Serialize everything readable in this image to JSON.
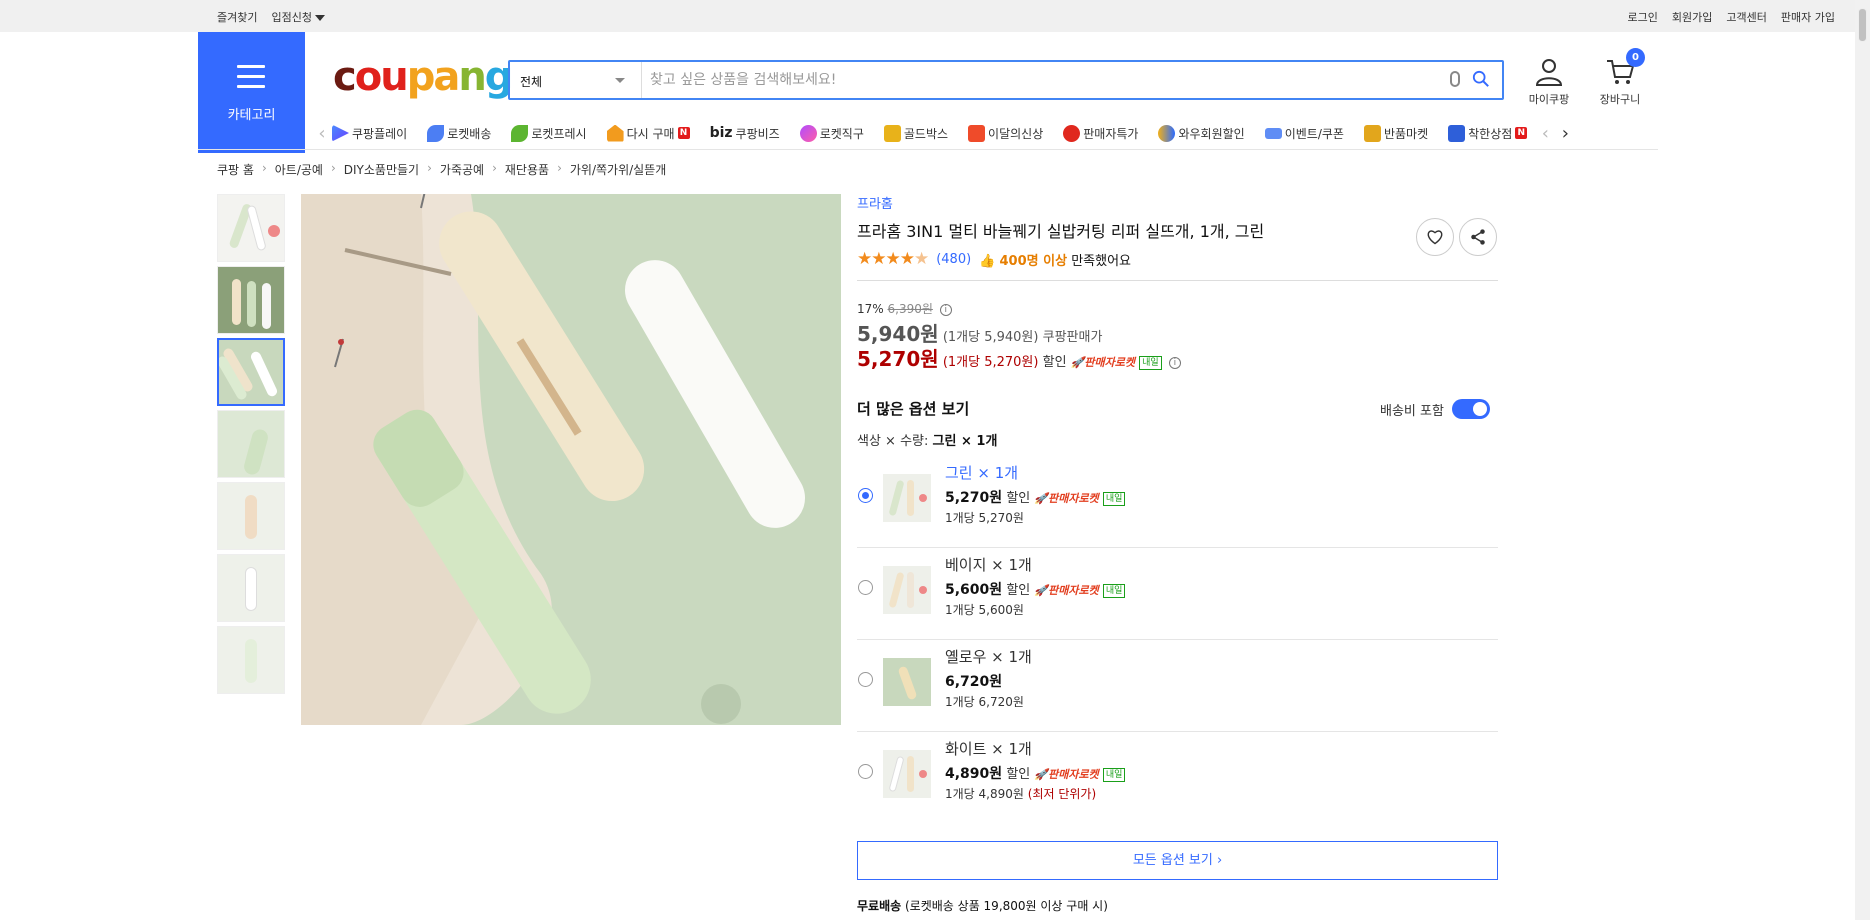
{
  "topbar": {
    "bookmark": "즐겨찾기",
    "apply": "입점신청",
    "login": "로그인",
    "signup": "회원가입",
    "support": "고객센터",
    "seller_signup": "판매자 가입"
  },
  "category_label": "카테고리",
  "logo": {
    "p1": "c",
    "p2": "ou",
    "p3": "pa",
    "p4": "n",
    "p5": "g"
  },
  "search": {
    "category": "전체",
    "placeholder": "찾고 싶은 상품을 검색해보세요!"
  },
  "header": {
    "my_coupang": "마이쿠팡",
    "cart": "장바구니",
    "cart_count": "0"
  },
  "nav": {
    "items": [
      "쿠팡플레이",
      "로켓배송",
      "로켓프레시",
      "다시 구매",
      "쿠팡비즈",
      "로켓직구",
      "골드박스",
      "이달의신상",
      "판매자특가",
      "와우회원할인",
      "이벤트/쿠폰",
      "반품마켓",
      "착한상점"
    ],
    "biz_prefix": "biz",
    "new_badge": "N"
  },
  "breadcrumb": [
    "쿠팡 홈",
    "아트/공예",
    "DIY소품만들기",
    "가죽공예",
    "재단용품",
    "가위/쪽가위/실뜯개"
  ],
  "product": {
    "brand": "프라홈",
    "title": "프라홈 3IN1 멀티 바늘꿰기 실밥커팅 리퍼 실뜨개, 1개, 그린",
    "review_count": "(480)",
    "satisfaction_bold": "400명 이상",
    "satisfaction_rest": "만족했어요",
    "rating": 4.5,
    "discount_rate": "17%",
    "original_price": "6,390원",
    "price": "5,940원",
    "price_unit": "(1개당 5,940원)",
    "price_label": "쿠팡판매가",
    "sale_price": "5,270원",
    "sale_unit": "(1개당 5,270원)",
    "sale_label": "할인",
    "rocket_label": "판매자로켓",
    "tomorrow": "내일"
  },
  "options": {
    "title": "더 많은 옵션 보기",
    "shipping_include": "배송비 포함",
    "selection_prefix": "색상 × 수량:",
    "selection_value": "그린 × 1개",
    "items": [
      {
        "name": "그린 × 1개",
        "price": "5,270원",
        "discount": "할인",
        "unit": "1개당 5,270원",
        "rocket": true
      },
      {
        "name": "베이지 × 1개",
        "price": "5,600원",
        "discount": "할인",
        "unit": "1개당 5,600원",
        "rocket": true
      },
      {
        "name": "옐로우 × 1개",
        "price": "6,720원",
        "discount": "",
        "unit": "1개당 6,720원",
        "rocket": false
      },
      {
        "name": "화이트 × 1개",
        "price": "4,890원",
        "discount": "할인",
        "unit": "1개당 4,890원",
        "lowest": "(최저 단위가)",
        "rocket": true
      }
    ],
    "view_all": "모든 옵션 보기 ›"
  },
  "shipping": {
    "free_bold": "무료배송",
    "free_rest": "(로켓배송 상품 19,800원 이상 구매 시)"
  }
}
